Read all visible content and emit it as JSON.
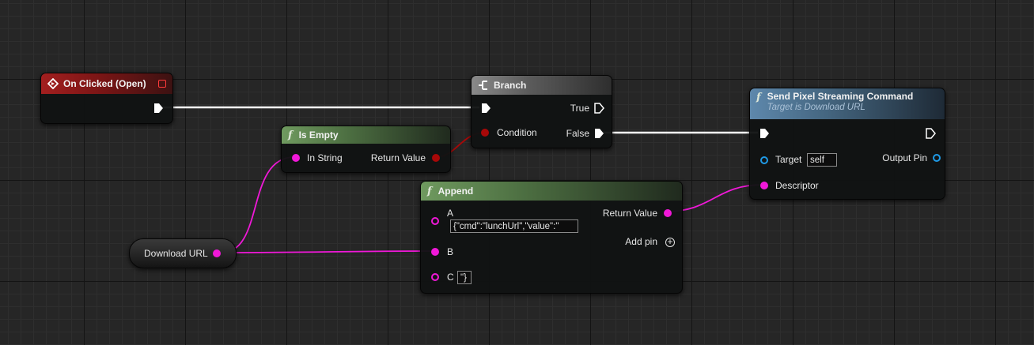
{
  "colors": {
    "exec_wire": "#ffffff",
    "string_pin": "#f018d8",
    "bool_pin": "#a80808",
    "object_pin": "#1f9ae6"
  },
  "nodes": {
    "on_clicked": {
      "title": "On Clicked (Open)",
      "icon": "event-diamond-icon"
    },
    "branch": {
      "title": "Branch",
      "icon": "branch-icon",
      "true_label": "True",
      "false_label": "False",
      "condition_label": "Condition"
    },
    "is_empty": {
      "title": "Is Empty",
      "icon": "function-icon",
      "in_string_label": "In String",
      "return_label": "Return Value"
    },
    "append": {
      "title": "Append",
      "icon": "function-icon",
      "a_label": "A",
      "a_value": "{\"cmd\":\"lunchUrl\",\"value\":\"",
      "b_label": "B",
      "c_label": "C",
      "c_value": "\"}",
      "return_label": "Return Value",
      "add_pin_label": "Add pin"
    },
    "send_cmd": {
      "title": "Send Pixel Streaming Command",
      "subtitle": "Target is Download URL",
      "icon": "function-icon",
      "target_label": "Target",
      "target_value": "self",
      "output_label": "Output Pin",
      "descriptor_label": "Descriptor"
    },
    "download_url": {
      "label": "Download URL"
    }
  }
}
